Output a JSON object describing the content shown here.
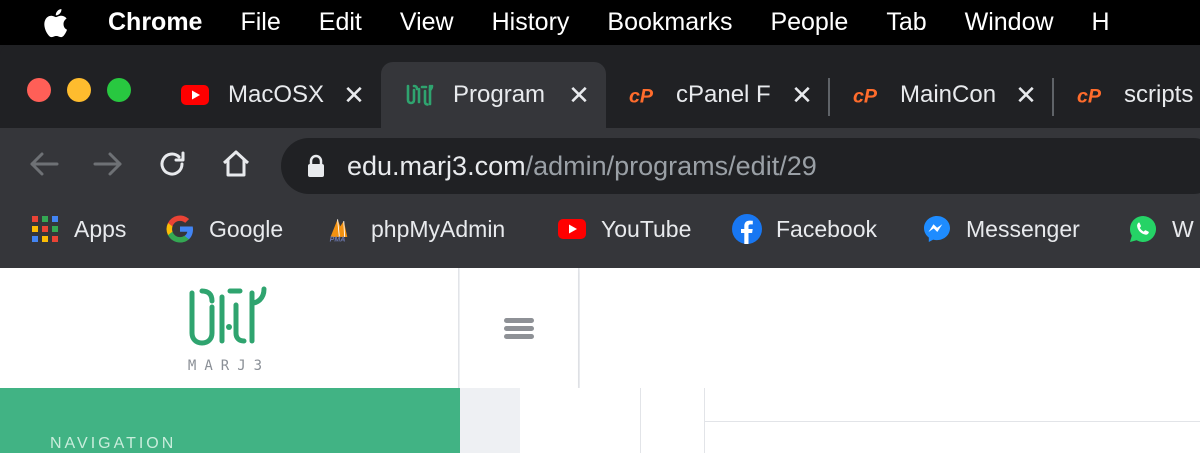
{
  "menubar": {
    "items": [
      "Chrome",
      "File",
      "Edit",
      "View",
      "History",
      "Bookmarks",
      "People",
      "Tab",
      "Window",
      "H"
    ]
  },
  "tabs": [
    {
      "title": "MacOSX",
      "icon": "youtube-icon",
      "active": false
    },
    {
      "title": "Program",
      "icon": "marj3-icon",
      "active": true
    },
    {
      "title": "cPanel F",
      "icon": "cpanel-icon",
      "active": false
    },
    {
      "title": "MainCon",
      "icon": "cpanel-icon",
      "active": false
    },
    {
      "title": "scripts",
      "icon": "cpanel-icon",
      "active": false
    }
  ],
  "omnibox": {
    "host": "edu.marj3.com",
    "path": "/admin/programs/edit/29"
  },
  "bookmarks": [
    {
      "label": "Apps",
      "icon": "apps-grid-icon"
    },
    {
      "label": "Google",
      "icon": "google-icon"
    },
    {
      "label": "phpMyAdmin",
      "icon": "phpmyadmin-icon"
    },
    {
      "label": "YouTube",
      "icon": "youtube-icon"
    },
    {
      "label": "Facebook",
      "icon": "facebook-icon"
    },
    {
      "label": "Messenger",
      "icon": "messenger-icon"
    },
    {
      "label": "W",
      "icon": "whatsapp-icon"
    }
  ],
  "page": {
    "logo_text": "MARJ3",
    "nav_label": "NAVIGATION"
  },
  "colors": {
    "brand_green": "#41b384",
    "logo_green": "#2fa46f",
    "cpanel_orange": "#ff6c2c",
    "youtube_red": "#ff0000"
  }
}
